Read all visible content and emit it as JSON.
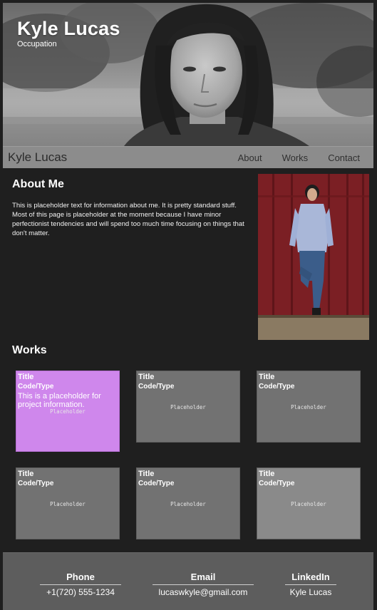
{
  "hero": {
    "name": "Kyle Lucas",
    "occupation": "Occupation"
  },
  "nav": {
    "brand": "Kyle Lucas",
    "links": [
      "About",
      "Works",
      "Contact"
    ]
  },
  "about": {
    "title": "About Me",
    "text": "This is placeholder text for information about me. It is pretty standard stuff. Most of this page is placeholder at the moment because I have minor perfectionist tendencies and will spend too much time focusing on things that don't matter."
  },
  "works": {
    "title": "Works",
    "cards": [
      {
        "title": "Title",
        "type": "Code/Type",
        "placeholder": "Placeholder",
        "description": "This is a placeholder for project information."
      },
      {
        "title": "Title",
        "type": "Code/Type",
        "placeholder": "Placeholder"
      },
      {
        "title": "Title",
        "type": "Code/Type",
        "placeholder": "Placeholder"
      },
      {
        "title": "Title",
        "type": "Code/Type",
        "placeholder": "Placeholder"
      },
      {
        "title": "Title",
        "type": "Code/Type",
        "placeholder": "Placeholder"
      },
      {
        "title": "Title",
        "type": "Code/Type",
        "placeholder": "Placeholder"
      }
    ]
  },
  "footer": {
    "phone": {
      "label": "Phone",
      "value": "+1(720) 555-1234"
    },
    "email": {
      "label": "Email",
      "value": "lucaswkyle@gmail.com"
    },
    "linkedin": {
      "label": "LinkedIn",
      "value": "Kyle Lucas"
    }
  },
  "colors": {
    "background": "#1f1f1f",
    "navbar": "#8c8c8c",
    "card": "#727272",
    "card_active": "#cf87ec",
    "footer": "#5d5d5d"
  }
}
